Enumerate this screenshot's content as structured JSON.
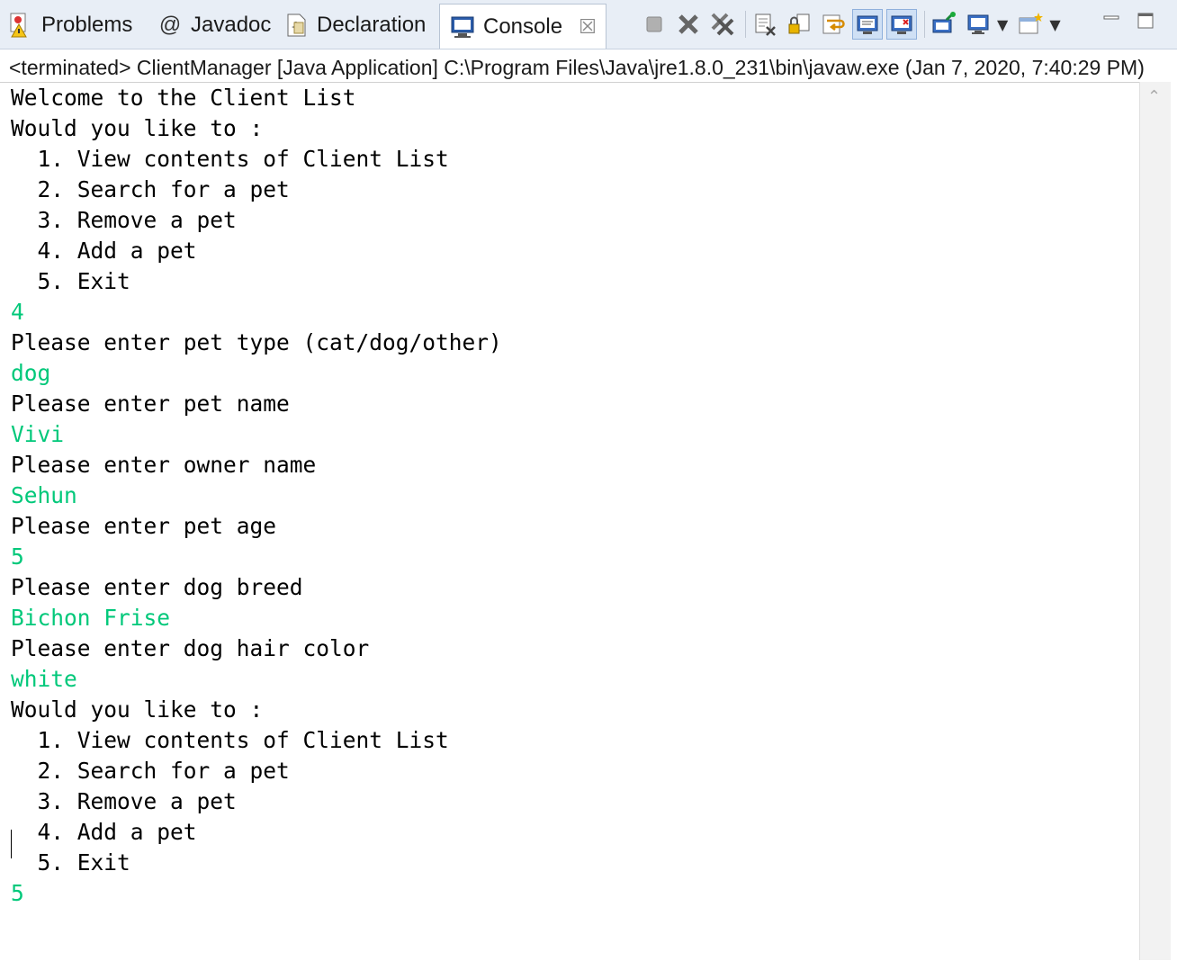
{
  "tabs": [
    {
      "label": "Problems",
      "icon": "problems-icon"
    },
    {
      "label": "Javadoc",
      "icon": "javadoc-icon"
    },
    {
      "label": "Declaration",
      "icon": "declaration-icon"
    },
    {
      "label": "Console",
      "icon": "console-icon",
      "active": true
    }
  ],
  "launch_info": "<terminated> ClientManager [Java Application] C:\\Program Files\\Java\\jre1.8.0_231\\bin\\javaw.exe (Jan 7, 2020, 7:40:29 PM)",
  "console_lines": [
    {
      "text": "Welcome to the Client List",
      "input": false
    },
    {
      "text": "Would you like to :",
      "input": false
    },
    {
      "text": "  1. View contents of Client List",
      "input": false
    },
    {
      "text": "  2. Search for a pet",
      "input": false
    },
    {
      "text": "  3. Remove a pet",
      "input": false
    },
    {
      "text": "  4. Add a pet",
      "input": false
    },
    {
      "text": "  5. Exit",
      "input": false
    },
    {
      "text": "4",
      "input": true
    },
    {
      "text": "Please enter pet type (cat/dog/other)",
      "input": false
    },
    {
      "text": "dog",
      "input": true
    },
    {
      "text": "Please enter pet name",
      "input": false
    },
    {
      "text": "Vivi",
      "input": true
    },
    {
      "text": "Please enter owner name",
      "input": false
    },
    {
      "text": "Sehun",
      "input": true
    },
    {
      "text": "Please enter pet age",
      "input": false
    },
    {
      "text": "5",
      "input": true
    },
    {
      "text": "Please enter dog breed",
      "input": false
    },
    {
      "text": "Bichon Frise",
      "input": true
    },
    {
      "text": "Please enter dog hair color",
      "input": false
    },
    {
      "text": "white",
      "input": true
    },
    {
      "text": "Would you like to :",
      "input": false
    },
    {
      "text": "  1. View contents of Client List",
      "input": false
    },
    {
      "text": "  2. Search for a pet",
      "input": false
    },
    {
      "text": "  3. Remove a pet",
      "input": false
    },
    {
      "text": "  4. Add a pet",
      "input": false
    },
    {
      "text": "  5. Exit",
      "input": false
    },
    {
      "text": "5",
      "input": true
    }
  ],
  "colors": {
    "input_text": "#00c87a",
    "output_text": "#000000"
  }
}
